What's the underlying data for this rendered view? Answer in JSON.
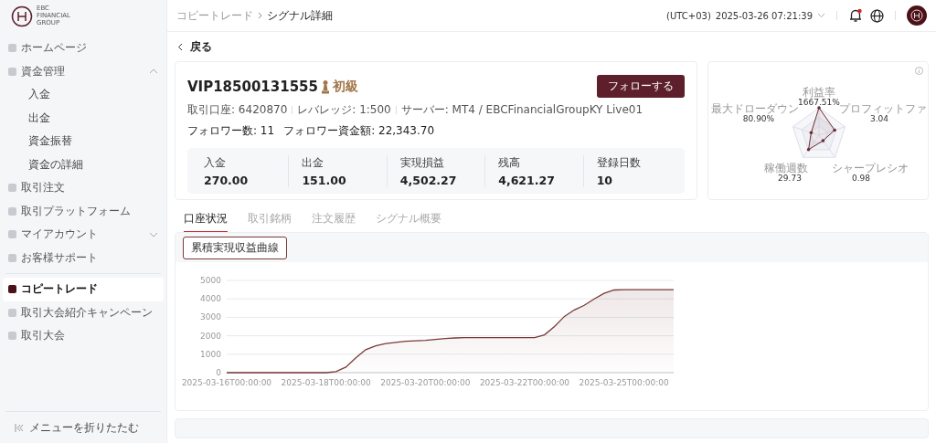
{
  "logo": {
    "text": "EBC FINANCIAL GROUP"
  },
  "sidebar": {
    "sections": [
      {
        "items": [
          {
            "label": "ホームページ",
            "selected": false
          },
          {
            "label": "資金管理",
            "selected": false,
            "expanded": true,
            "children": [
              {
                "label": "入金",
                "selected": false
              },
              {
                "label": "出金",
                "selected": false
              },
              {
                "label": "資金振替",
                "selected": false
              },
              {
                "label": "資金の詳細",
                "selected": false
              }
            ]
          },
          {
            "label": "取引注文",
            "selected": false
          },
          {
            "label": "取引プラットフォーム",
            "selected": false
          },
          {
            "label": "マイアカウント",
            "selected": false,
            "expanded": false
          },
          {
            "label": "お客様サポート",
            "selected": false
          }
        ]
      },
      {
        "items": [
          {
            "label": "コピートレード",
            "selected": true
          },
          {
            "label": "取引大会紹介キャンペーン",
            "selected": false
          },
          {
            "label": "取引大会",
            "selected": false
          }
        ]
      }
    ],
    "collapse": "メニューを折りたたむ"
  },
  "breadcrumb": [
    "コピートレード",
    "シグナル詳細"
  ],
  "header": {
    "timezone": "(UTC+03)",
    "datetime": "2025-03-26 07:21:39",
    "notification": true
  },
  "back": "戻る",
  "signal": {
    "name": "VIP18500131555",
    "level": "初級",
    "follow_button": "フォローする",
    "meta": [
      "取引口座: 6420870",
      "レバレッジ: 1:500",
      "サーバー: MT4 / EBCFinancialGroupKY Live01"
    ],
    "followers": [
      "フォロワー数: 11",
      "フォロワー資金額: 22,343.70"
    ],
    "stats": [
      {
        "label": "入金",
        "value": "270.00"
      },
      {
        "label": "出金",
        "value": "151.00"
      },
      {
        "label": "実現損益",
        "value": "4,502.27"
      },
      {
        "label": "残高",
        "value": "4,621.27"
      },
      {
        "label": "登録日数",
        "value": "10"
      }
    ]
  },
  "radar": {
    "axes": [
      {
        "label": "利益率",
        "value": "1667.51%"
      },
      {
        "label": "最大ドローダウン",
        "value": "80.90%"
      },
      {
        "label": "プロフィットファ",
        "value": "3.04"
      },
      {
        "label": "稼働週数",
        "value": "29.73"
      },
      {
        "label": "シャープレシオ",
        "value": "0.98"
      }
    ]
  },
  "tabs": [
    {
      "label": "口座状況",
      "selected": true
    },
    {
      "label": "取引銘柄",
      "selected": false
    },
    {
      "label": "注文履歴",
      "selected": false
    },
    {
      "label": "シグナル概要",
      "selected": false
    }
  ],
  "chart_panel": {
    "button": "累積実現収益曲線",
    "chart_data": {
      "type": "area",
      "categories": [
        "2025-03-16T00:00:00",
        null,
        null,
        null,
        null,
        null,
        null,
        null,
        null,
        null,
        "2025-03-18T00:00:00",
        null,
        null,
        null,
        null,
        null,
        null,
        null,
        null,
        null,
        "2025-03-20T00:00:00",
        null,
        null,
        null,
        null,
        null,
        null,
        null,
        null,
        null,
        "2025-03-22T00:00:00",
        null,
        null,
        null,
        null,
        null,
        null,
        null,
        null,
        null,
        "2025-03-25T00:00:00",
        null,
        null,
        null,
        null,
        null
      ],
      "series": [
        {
          "color": "#7a3a3a",
          "values": [
            0,
            0,
            0,
            0,
            0,
            0,
            0,
            0,
            0,
            0,
            0,
            60,
            300,
            800,
            1250,
            1450,
            1580,
            1640,
            1700,
            1730,
            1750,
            1800,
            1850,
            1880,
            1900,
            1900,
            1900,
            1900,
            1900,
            1900,
            1900,
            1900,
            2050,
            2500,
            3050,
            3400,
            3650,
            4000,
            4300,
            4480,
            4500,
            4500,
            4500,
            4500,
            4500,
            4500
          ]
        }
      ],
      "ylim": [
        0,
        5000
      ],
      "grid": true,
      "yticks": [
        0,
        1000,
        2000,
        3000,
        4000,
        5000
      ]
    }
  }
}
